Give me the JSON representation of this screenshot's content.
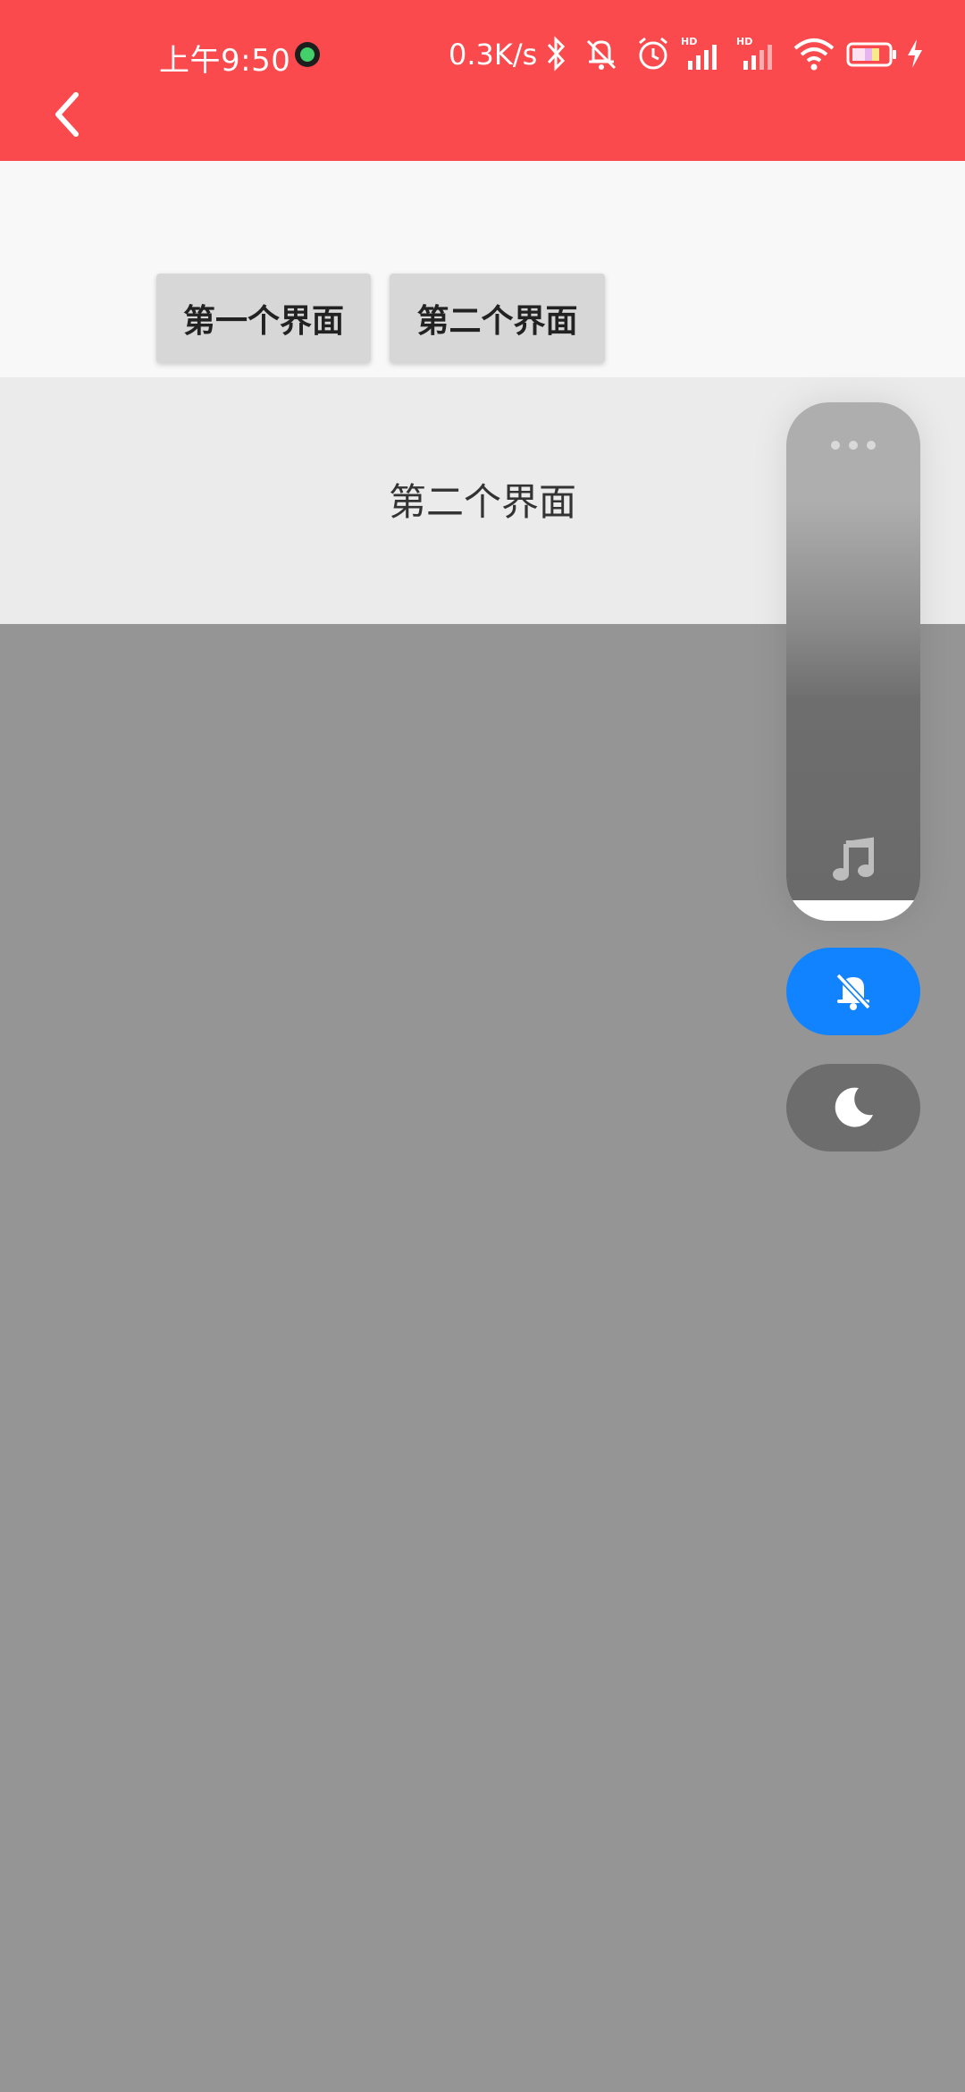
{
  "status_bar": {
    "time": "上午9:50",
    "net_speed": "0.3K/s",
    "icons": [
      "app-notification-icon",
      "bluetooth-icon",
      "muted-bell-icon",
      "alarm-icon",
      "hd-signal-icon",
      "hd-signal-icon",
      "wifi-icon",
      "battery-icon",
      "charging-bolt-icon"
    ],
    "hd_label": "HD"
  },
  "header": {
    "back_icon": "chevron-left-icon",
    "background_color": "#fb4a4d"
  },
  "tabs": [
    {
      "label": "第一个界面"
    },
    {
      "label": "第二个界面"
    }
  ],
  "main": {
    "page_label": "第二个界面"
  },
  "volume_panel": {
    "more_icon": "more-dots-icon",
    "stream_icon": "music-note-icon",
    "level": 0.96,
    "mute_icon": "muted-bell-icon",
    "mute_color": "#1283ff",
    "dnd_icon": "moon-icon"
  }
}
